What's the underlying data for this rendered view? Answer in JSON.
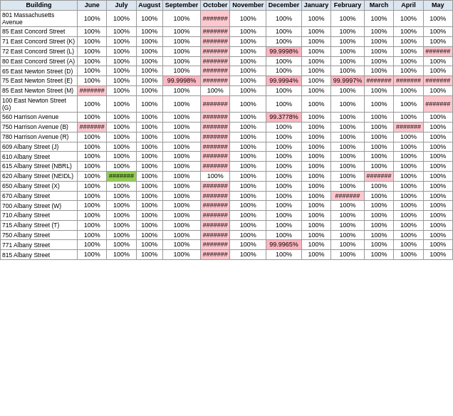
{
  "table": {
    "columns": [
      "Building",
      "June",
      "July",
      "August",
      "September",
      "October",
      "November",
      "December",
      "January",
      "February",
      "March",
      "April",
      "May"
    ],
    "rows": [
      {
        "building": "801 Massachusetts Avenue",
        "values": [
          "100%",
          "100%",
          "100%",
          "100%",
          "#######",
          "100%",
          "100%",
          "100%",
          "100%",
          "100%",
          "100%",
          "100%"
        ],
        "styles": [
          "n",
          "n",
          "n",
          "n",
          "hash",
          "n",
          "n",
          "n",
          "n",
          "n",
          "n",
          "n"
        ]
      },
      {
        "building": "85 East Concord Street",
        "values": [
          "100%",
          "100%",
          "100%",
          "100%",
          "#######",
          "100%",
          "100%",
          "100%",
          "100%",
          "100%",
          "100%",
          "100%"
        ],
        "styles": [
          "n",
          "n",
          "n",
          "n",
          "hash",
          "n",
          "n",
          "n",
          "n",
          "n",
          "n",
          "n"
        ]
      },
      {
        "building": "71 East Concord Street (K)",
        "values": [
          "100%",
          "100%",
          "100%",
          "100%",
          "#######",
          "100%",
          "100%",
          "100%",
          "100%",
          "100%",
          "100%",
          "100%"
        ],
        "styles": [
          "n",
          "n",
          "n",
          "n",
          "hash",
          "n",
          "n",
          "n",
          "n",
          "n",
          "n",
          "n"
        ]
      },
      {
        "building": "72 East Concord Street (L)",
        "values": [
          "100%",
          "100%",
          "100%",
          "100%",
          "#######",
          "100%",
          "99.9998%",
          "100%",
          "100%",
          "100%",
          "100%",
          "#######"
        ],
        "styles": [
          "n",
          "n",
          "n",
          "n",
          "hash",
          "n",
          "pink",
          "n",
          "n",
          "n",
          "n",
          "hash"
        ]
      },
      {
        "building": "80 East Concord Street (A)",
        "values": [
          "100%",
          "100%",
          "100%",
          "100%",
          "#######",
          "100%",
          "100%",
          "100%",
          "100%",
          "100%",
          "100%",
          "100%"
        ],
        "styles": [
          "n",
          "n",
          "n",
          "n",
          "hash",
          "n",
          "n",
          "n",
          "n",
          "n",
          "n",
          "n"
        ]
      },
      {
        "building": "65 East Newton Street (D)",
        "values": [
          "100%",
          "100%",
          "100%",
          "100%",
          "#######",
          "100%",
          "100%",
          "100%",
          "100%",
          "100%",
          "100%",
          "100%"
        ],
        "styles": [
          "n",
          "n",
          "n",
          "n",
          "hash",
          "n",
          "n",
          "n",
          "n",
          "n",
          "n",
          "n"
        ]
      },
      {
        "building": "75 East Newton Street (E)",
        "values": [
          "100%",
          "100%",
          "100%",
          "99.9998%",
          "#######",
          "100%",
          "99.9994%",
          "100%",
          "99.9997%",
          "#######",
          "#######",
          "#######"
        ],
        "styles": [
          "n",
          "n",
          "n",
          "pink",
          "hash",
          "n",
          "pink",
          "n",
          "pink",
          "hash",
          "hash",
          "hash"
        ]
      },
      {
        "building": "85 East Newton Street (M)",
        "values": [
          "#######",
          "100%",
          "100%",
          "100%",
          "100%",
          "100%",
          "100%",
          "100%",
          "100%",
          "100%",
          "100%",
          "100%"
        ],
        "styles": [
          "hash",
          "n",
          "n",
          "n",
          "n",
          "n",
          "n",
          "n",
          "n",
          "n",
          "n",
          "n"
        ]
      },
      {
        "building": "100 East Newton Street (G)",
        "values": [
          "100%",
          "100%",
          "100%",
          "100%",
          "#######",
          "100%",
          "100%",
          "100%",
          "100%",
          "100%",
          "100%",
          "#######"
        ],
        "styles": [
          "n",
          "n",
          "n",
          "n",
          "hash",
          "n",
          "n",
          "n",
          "n",
          "n",
          "n",
          "hash"
        ]
      },
      {
        "building": "560 Harrison Avenue",
        "values": [
          "100%",
          "100%",
          "100%",
          "100%",
          "#######",
          "100%",
          "99.3778%",
          "100%",
          "100%",
          "100%",
          "100%",
          "100%"
        ],
        "styles": [
          "n",
          "n",
          "n",
          "n",
          "hash",
          "n",
          "pink",
          "n",
          "n",
          "n",
          "n",
          "n"
        ]
      },
      {
        "building": "750 Harrison Avenue (B)",
        "values": [
          "#######",
          "100%",
          "100%",
          "100%",
          "#######",
          "100%",
          "100%",
          "100%",
          "100%",
          "100%",
          "#######",
          "100%"
        ],
        "styles": [
          "hash",
          "n",
          "n",
          "n",
          "hash",
          "n",
          "n",
          "n",
          "n",
          "n",
          "hash",
          "n"
        ]
      },
      {
        "building": "780 Harrison Avenue (R)",
        "values": [
          "100%",
          "100%",
          "100%",
          "100%",
          "#######",
          "100%",
          "100%",
          "100%",
          "100%",
          "100%",
          "100%",
          "100%"
        ],
        "styles": [
          "n",
          "n",
          "n",
          "n",
          "hash",
          "n",
          "n",
          "n",
          "n",
          "n",
          "n",
          "n"
        ]
      },
      {
        "building": "609 Albany Street (J)",
        "values": [
          "100%",
          "100%",
          "100%",
          "100%",
          "#######",
          "100%",
          "100%",
          "100%",
          "100%",
          "100%",
          "100%",
          "100%"
        ],
        "styles": [
          "n",
          "n",
          "n",
          "n",
          "hash",
          "n",
          "n",
          "n",
          "n",
          "n",
          "n",
          "n"
        ]
      },
      {
        "building": "610 Albany Street",
        "values": [
          "100%",
          "100%",
          "100%",
          "100%",
          "#######",
          "100%",
          "100%",
          "100%",
          "100%",
          "100%",
          "100%",
          "100%"
        ],
        "styles": [
          "n",
          "n",
          "n",
          "n",
          "hash",
          "n",
          "n",
          "n",
          "n",
          "n",
          "n",
          "n"
        ]
      },
      {
        "building": "615 Albany Street (NBRL)",
        "values": [
          "100%",
          "100%",
          "100%",
          "100%",
          "#######",
          "100%",
          "100%",
          "100%",
          "100%",
          "100%",
          "100%",
          "100%"
        ],
        "styles": [
          "n",
          "n",
          "n",
          "n",
          "hash",
          "n",
          "n",
          "n",
          "n",
          "n",
          "n",
          "n"
        ]
      },
      {
        "building": "620 Albany Street (NEIDL)",
        "values": [
          "100%",
          "#######",
          "100%",
          "100%",
          "100%",
          "100%",
          "100%",
          "100%",
          "100%",
          "#######",
          "100%",
          "100%"
        ],
        "styles": [
          "n",
          "green",
          "n",
          "n",
          "n",
          "n",
          "n",
          "n",
          "n",
          "hash",
          "n",
          "n"
        ]
      },
      {
        "building": "650 Albany Street (X)",
        "values": [
          "100%",
          "100%",
          "100%",
          "100%",
          "#######",
          "100%",
          "100%",
          "100%",
          "100%",
          "100%",
          "100%",
          "100%"
        ],
        "styles": [
          "n",
          "n",
          "n",
          "n",
          "hash",
          "n",
          "n",
          "n",
          "n",
          "n",
          "n",
          "n"
        ]
      },
      {
        "building": "670 Albany Street",
        "values": [
          "100%",
          "100%",
          "100%",
          "100%",
          "#######",
          "100%",
          "100%",
          "100%",
          "#######",
          "100%",
          "100%",
          "100%"
        ],
        "styles": [
          "n",
          "n",
          "n",
          "n",
          "hash",
          "n",
          "n",
          "n",
          "hash",
          "n",
          "n",
          "n"
        ]
      },
      {
        "building": "700 Albany Street (W)",
        "values": [
          "100%",
          "100%",
          "100%",
          "100%",
          "#######",
          "100%",
          "100%",
          "100%",
          "100%",
          "100%",
          "100%",
          "100%"
        ],
        "styles": [
          "n",
          "n",
          "n",
          "n",
          "hash",
          "n",
          "n",
          "n",
          "n",
          "n",
          "n",
          "n"
        ]
      },
      {
        "building": "710 Albany Street",
        "values": [
          "100%",
          "100%",
          "100%",
          "100%",
          "#######",
          "100%",
          "100%",
          "100%",
          "100%",
          "100%",
          "100%",
          "100%"
        ],
        "styles": [
          "n",
          "n",
          "n",
          "n",
          "hash",
          "n",
          "n",
          "n",
          "n",
          "n",
          "n",
          "n"
        ]
      },
      {
        "building": "715 Albany Street (T)",
        "values": [
          "100%",
          "100%",
          "100%",
          "100%",
          "#######",
          "100%",
          "100%",
          "100%",
          "100%",
          "100%",
          "100%",
          "100%"
        ],
        "styles": [
          "n",
          "n",
          "n",
          "n",
          "hash",
          "n",
          "n",
          "n",
          "n",
          "n",
          "n",
          "n"
        ]
      },
      {
        "building": "750 Albany Street",
        "values": [
          "100%",
          "100%",
          "100%",
          "100%",
          "#######",
          "100%",
          "100%",
          "100%",
          "100%",
          "100%",
          "100%",
          "100%"
        ],
        "styles": [
          "n",
          "n",
          "n",
          "n",
          "hash",
          "n",
          "n",
          "n",
          "n",
          "n",
          "n",
          "n"
        ]
      },
      {
        "building": "771 Albany Street",
        "values": [
          "100%",
          "100%",
          "100%",
          "100%",
          "#######",
          "100%",
          "99.9965%",
          "100%",
          "100%",
          "100%",
          "100%",
          "100%"
        ],
        "styles": [
          "n",
          "n",
          "n",
          "n",
          "hash",
          "n",
          "pink",
          "n",
          "n",
          "n",
          "n",
          "n"
        ]
      },
      {
        "building": "815 Albany Street",
        "values": [
          "100%",
          "100%",
          "100%",
          "100%",
          "#######",
          "100%",
          "100%",
          "100%",
          "100%",
          "100%",
          "100%",
          "100%"
        ],
        "styles": [
          "n",
          "n",
          "n",
          "n",
          "hash",
          "n",
          "n",
          "n",
          "n",
          "n",
          "n",
          "n"
        ]
      }
    ]
  }
}
